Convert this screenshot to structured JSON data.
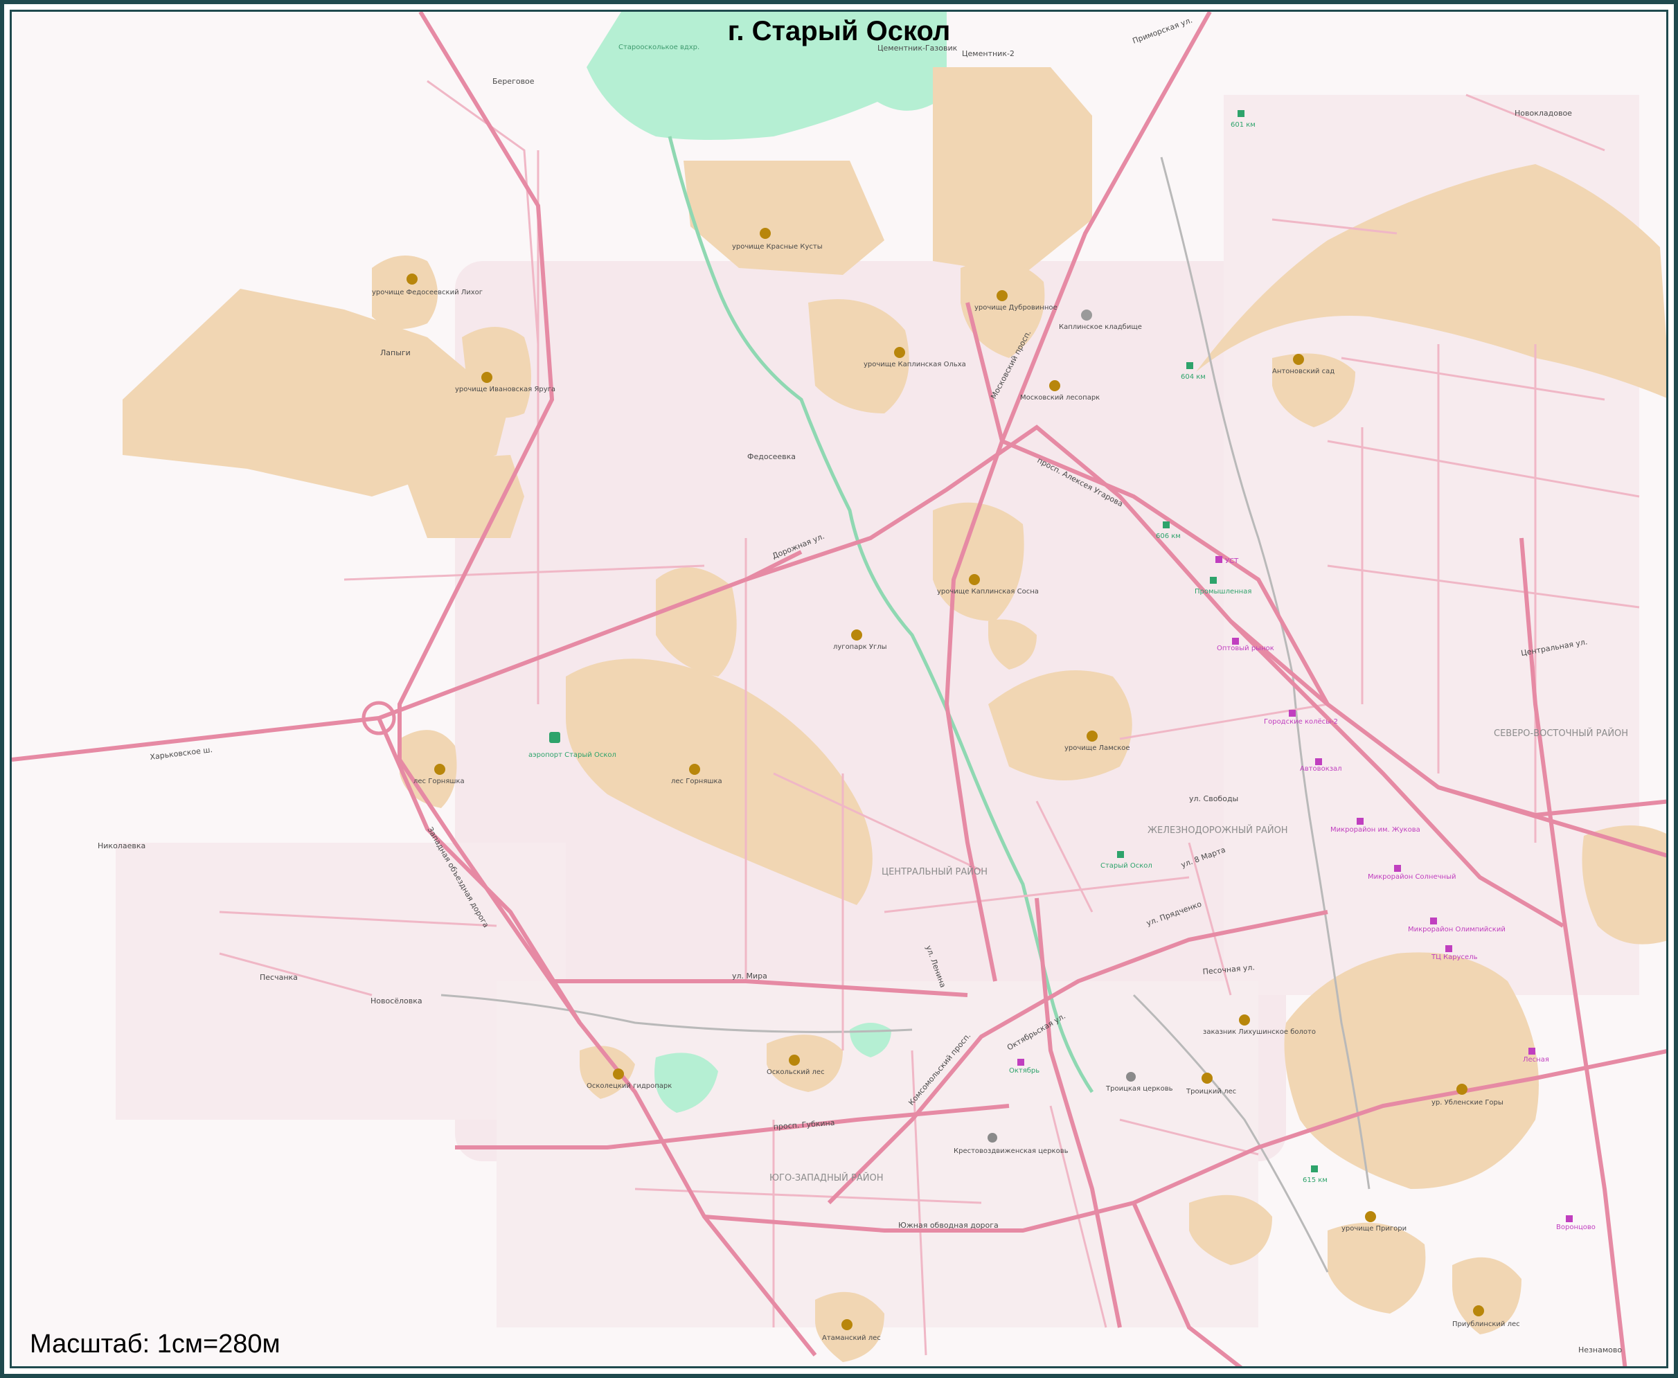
{
  "map": {
    "title": "г. Старый Оскол",
    "scale": "Масштаб: 1см=280м",
    "colors": {
      "background": "#fbf7f8",
      "forest": "#f1d6b3",
      "urban": "#f5e6ea",
      "water": "#b5efd3",
      "road_major": "#e68aa4",
      "road_minor": "#f0b7c6",
      "frame": "#1f4a4e",
      "poi": "#b8860b",
      "station": "#2ea36b",
      "shop": "#c03fbf"
    },
    "districts": [
      {
        "name": "ЦЕНТРАЛЬНЫЙ РАЙОН"
      },
      {
        "name": "ЖЕЛЕЗНОДОРОЖНЫЙ РАЙОН"
      },
      {
        "name": "ЮГО-ЗАПАДНЫЙ РАЙОН"
      },
      {
        "name": "СЕВЕРО-ВОСТОЧНЫЙ РАЙОН"
      }
    ],
    "settlements": [
      {
        "name": "Береговое"
      },
      {
        "name": "Лапыги"
      },
      {
        "name": "Федосеевка"
      },
      {
        "name": "Николаевка"
      },
      {
        "name": "Песчанка"
      },
      {
        "name": "Новосёловка"
      },
      {
        "name": "Новокладовое"
      },
      {
        "name": "Незнамово"
      },
      {
        "name": "Цементник-Газовик"
      },
      {
        "name": "Цементник-2"
      }
    ],
    "pois": [
      {
        "name": "урочище Федосеевский Лихог",
        "icon": "park-icon"
      },
      {
        "name": "урочище Ивановская Яруга",
        "icon": "park-icon"
      },
      {
        "name": "урочище Красные Кусты",
        "icon": "park-icon"
      },
      {
        "name": "урочище Дубровинное",
        "icon": "park-icon"
      },
      {
        "name": "урочище Каплинская Ольха",
        "icon": "park-icon"
      },
      {
        "name": "Московский лесопарк",
        "icon": "park-icon"
      },
      {
        "name": "урочище Каплинская Сосна",
        "icon": "park-icon"
      },
      {
        "name": "лугопарк Углы",
        "icon": "park-icon"
      },
      {
        "name": "лес Горняшка",
        "icon": "park-icon"
      },
      {
        "name": "лес Горняшка",
        "icon": "park-icon"
      },
      {
        "name": "урочище Ламское",
        "icon": "park-icon"
      },
      {
        "name": "Антоновский сад",
        "icon": "park-icon"
      },
      {
        "name": "Оскольский лес",
        "icon": "park-icon"
      },
      {
        "name": "Осколецкий гидропарк",
        "icon": "park-icon"
      },
      {
        "name": "Троицкий лес",
        "icon": "park-icon"
      },
      {
        "name": "заказник Лихушинское болото",
        "icon": "park-icon"
      },
      {
        "name": "ур. Убленские Горы",
        "icon": "park-icon"
      },
      {
        "name": "урочище Пригори",
        "icon": "park-icon"
      },
      {
        "name": "Атаманский лес",
        "icon": "park-icon"
      },
      {
        "name": "Приублинский лес",
        "icon": "park-icon"
      },
      {
        "name": "Каплинское кладбище",
        "icon": "cemetery-icon"
      },
      {
        "name": "аэропорт Старый Оскол",
        "icon": "airport-icon"
      },
      {
        "name": "Троицкая церковь",
        "icon": "church-icon"
      },
      {
        "name": "Крестовоздвиженская церковь",
        "icon": "church-icon"
      },
      {
        "name": "Староосколькое вдхр.",
        "icon": "water-label"
      }
    ],
    "stations": [
      {
        "name": "Старый Оскол"
      },
      {
        "name": "601 км"
      },
      {
        "name": "604 км"
      },
      {
        "name": "606 км"
      },
      {
        "name": "615 км"
      },
      {
        "name": "Промышленная"
      }
    ],
    "shops": [
      {
        "name": "УСТ"
      },
      {
        "name": "Оптовый рынок"
      },
      {
        "name": "Городские колёсы-2"
      },
      {
        "name": "Автовокзал"
      },
      {
        "name": "Микрорайон им. Жукова"
      },
      {
        "name": "Микрорайон Солнечный"
      },
      {
        "name": "Микрорайон Олимпийский"
      },
      {
        "name": "ТЦ Карусель"
      },
      {
        "name": "Лесная"
      },
      {
        "name": "Воронцово"
      },
      {
        "name": "Октябрь"
      }
    ],
    "roads": [
      {
        "name": "Харьковское ш."
      },
      {
        "name": "Дорожная ул."
      },
      {
        "name": "Московский просп."
      },
      {
        "name": "просп. Алексея Угарова"
      },
      {
        "name": "ул. Мира"
      },
      {
        "name": "просп. Губкина"
      },
      {
        "name": "Южная обводная дорога"
      },
      {
        "name": "Западная объездная дорога"
      },
      {
        "name": "Комсомольский просп."
      },
      {
        "name": "ул. Ленина"
      },
      {
        "name": "Октябрьская ул."
      },
      {
        "name": "Песочная ул."
      },
      {
        "name": "ул. Прядченко"
      },
      {
        "name": "Приморская ул."
      },
      {
        "name": "ул. Свободы"
      },
      {
        "name": "Центральная ул."
      },
      {
        "name": "ул. 8 Марта"
      }
    ]
  }
}
